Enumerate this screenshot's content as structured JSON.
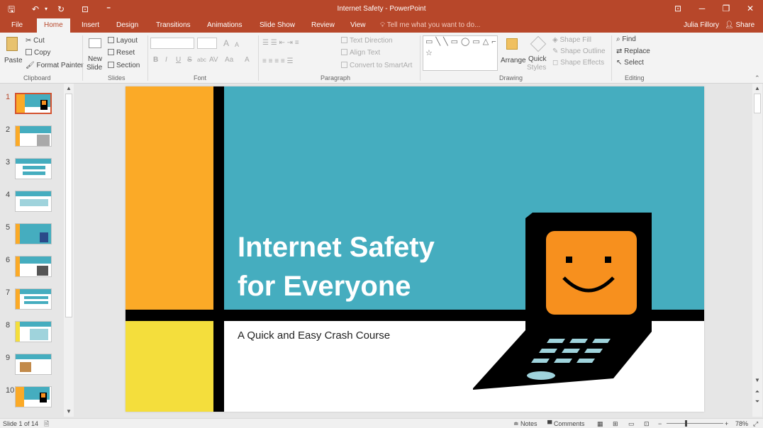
{
  "app": {
    "title": "Internet Safety - PowerPoint",
    "accent": "#b7472a"
  },
  "qat": {
    "save": "🖫",
    "undo": "↶",
    "undo_menu": "▾",
    "redo": "↻",
    "present": "⊡",
    "customize": "⁼"
  },
  "window": {
    "ribbon_display": "⊡",
    "minimize": "─",
    "restore": "❐",
    "close": "✕"
  },
  "tabs": [
    {
      "label": "File"
    },
    {
      "label": "Home"
    },
    {
      "label": "Insert"
    },
    {
      "label": "Design"
    },
    {
      "label": "Transitions"
    },
    {
      "label": "Animations"
    },
    {
      "label": "Slide Show"
    },
    {
      "label": "Review"
    },
    {
      "label": "View"
    }
  ],
  "tellme": "Tell me what you want to do...",
  "user": "Julia Fillory",
  "share": "Share",
  "ribbon": {
    "clipboard": {
      "paste": "Paste",
      "cut": "Cut",
      "copy": "Copy",
      "format_painter": "Format Painter",
      "label": "Clipboard"
    },
    "slides": {
      "new_slide_1": "New",
      "new_slide_2": "Slide",
      "layout": "Layout",
      "reset": "Reset",
      "section": "Section",
      "label": "Slides"
    },
    "font": {
      "label": "Font",
      "bold": "B",
      "italic": "I",
      "underline": "U",
      "strike": "S",
      "shadow": "abc",
      "spacing": "AV",
      "case": "Aa",
      "color": "A",
      "grow": "A",
      "shrink": "A"
    },
    "paragraph": {
      "text_direction": "Text Direction",
      "align_text": "Align Text",
      "smartart": "Convert to SmartArt",
      "label": "Paragraph"
    },
    "drawing": {
      "arrange": "Arrange",
      "quick_1": "Quick",
      "quick_2": "Styles",
      "shape_fill": "Shape Fill",
      "shape_outline": "Shape Outline",
      "shape_effects": "Shape Effects",
      "label": "Drawing",
      "shapes_glyphs": "▭╲╲▭◯▭△⌐↱⇨⇩⬡⌗⌒⌒{}☆"
    },
    "editing": {
      "find": "Find",
      "replace": "Replace",
      "select": "Select",
      "label": "Editing"
    }
  },
  "thumbnails": [
    {
      "num": "1"
    },
    {
      "num": "2"
    },
    {
      "num": "3"
    },
    {
      "num": "4"
    },
    {
      "num": "5"
    },
    {
      "num": "6"
    },
    {
      "num": "7"
    },
    {
      "num": "8"
    },
    {
      "num": "9"
    },
    {
      "num": "10"
    }
  ],
  "slide": {
    "title_line1": "Internet Safety",
    "title_line2": "for Everyone",
    "subtitle": "A Quick and Easy Crash Course",
    "colors": {
      "orange": "#fbaa27",
      "yellow": "#f4de3c",
      "teal": "#45adbf",
      "black": "#000000",
      "face": "#f7901e"
    }
  },
  "status": {
    "slide_info": "Slide 1 of 14",
    "notes": "Notes",
    "comments": "Comments",
    "zoom": "78%"
  }
}
